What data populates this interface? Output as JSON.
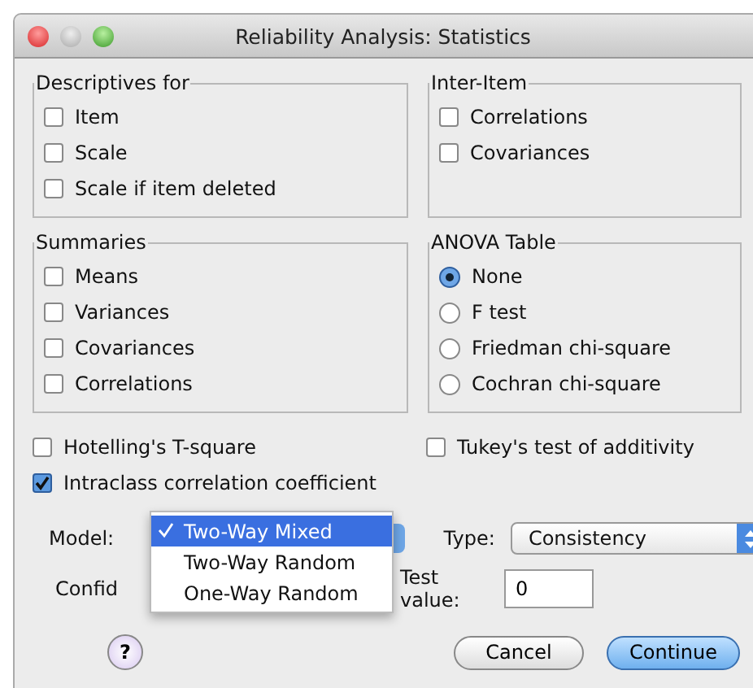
{
  "window": {
    "title": "Reliability Analysis: Statistics"
  },
  "groups": [
    {
      "title": "Descriptives for",
      "kind": "checkboxes",
      "items": [
        {
          "label": "Item",
          "checked": false
        },
        {
          "label": "Scale",
          "checked": false
        },
        {
          "label": "Scale if item deleted",
          "checked": false
        }
      ]
    },
    {
      "title": "Inter-Item",
      "kind": "checkboxes",
      "items": [
        {
          "label": "Correlations",
          "checked": false
        },
        {
          "label": "Covariances",
          "checked": false
        }
      ]
    },
    {
      "title": "Summaries",
      "kind": "checkboxes",
      "items": [
        {
          "label": "Means",
          "checked": false
        },
        {
          "label": "Variances",
          "checked": false
        },
        {
          "label": "Covariances",
          "checked": false
        },
        {
          "label": "Correlations",
          "checked": false
        }
      ]
    },
    {
      "title": "ANOVA Table",
      "kind": "radios",
      "items": [
        {
          "label": "None",
          "selected": true
        },
        {
          "label": "F test",
          "selected": false
        },
        {
          "label": "Friedman chi-square",
          "selected": false
        },
        {
          "label": "Cochran chi-square",
          "selected": false
        }
      ]
    }
  ],
  "options": [
    {
      "label": "Hotelling's T-square",
      "checked": false
    },
    {
      "label": "Tukey's test of additivity",
      "checked": false
    },
    {
      "label": "Intraclass correlation coefficient",
      "checked": true
    }
  ],
  "model": {
    "label": "Model:",
    "menu": [
      {
        "label": "Two-Way Mixed",
        "selected": true
      },
      {
        "label": "Two-Way Random",
        "selected": false
      },
      {
        "label": "One-Way Random",
        "selected": false
      }
    ]
  },
  "type": {
    "label": "Type:",
    "value": "Consistency"
  },
  "confidence": {
    "label": "Confid"
  },
  "test_value": {
    "label": "Test value:",
    "value": "0"
  },
  "buttons": [
    {
      "kind": "help",
      "label": "?"
    },
    {
      "kind": "normal",
      "label": "Cancel"
    },
    {
      "kind": "default",
      "label": "Continue"
    }
  ]
}
